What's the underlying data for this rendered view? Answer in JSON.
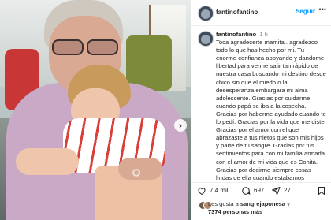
{
  "post": {
    "username": "fantinofantino",
    "follow_label": "Seguir",
    "more_label": "•••",
    "carousel_next": "›"
  },
  "caption": {
    "author": "fantinofantino",
    "time": "1 h",
    "text": "Toca agradecerte mamita.. agradezco todo lo que has hecho por mi. Tu enorme confianza apoyando y dandome libertad para verme salir tan rápido de nuestra casa buscando mi destino desde chico sin que el miedo o la desesperanza embargara mi alma adolescente. Gracias por cuidarme cuando papá se iba a la cosecha. Gracias por haberme ayudado cuando te lo pedí. Gracias por la vida que me diste. Gracias por el amor con el que abrazaste a tus nietos que son mis hijos y parte de tu sangre. Gracias por tus sentimientos para con mi familia armada con el amor de mi vida que es Conita. Gracias por decirme siempre cosas lindas de ella cuando estabamos"
  },
  "actions": {
    "likes_count": "7,4 mil",
    "comments_count": "697",
    "shares_count": "27",
    "like_icon": "heart-icon",
    "comment_icon": "comment-icon",
    "share_icon": "share-icon",
    "bookmark_icon": "bookmark-icon"
  },
  "likes_summary": {
    "prefix": "Les gusta a ",
    "user": "sangrejaponesa",
    "middle": " y ",
    "others": "7374 personas más"
  },
  "colors": {
    "follow": "#0095f6",
    "text": "#262626",
    "muted": "#8e8e8e"
  }
}
